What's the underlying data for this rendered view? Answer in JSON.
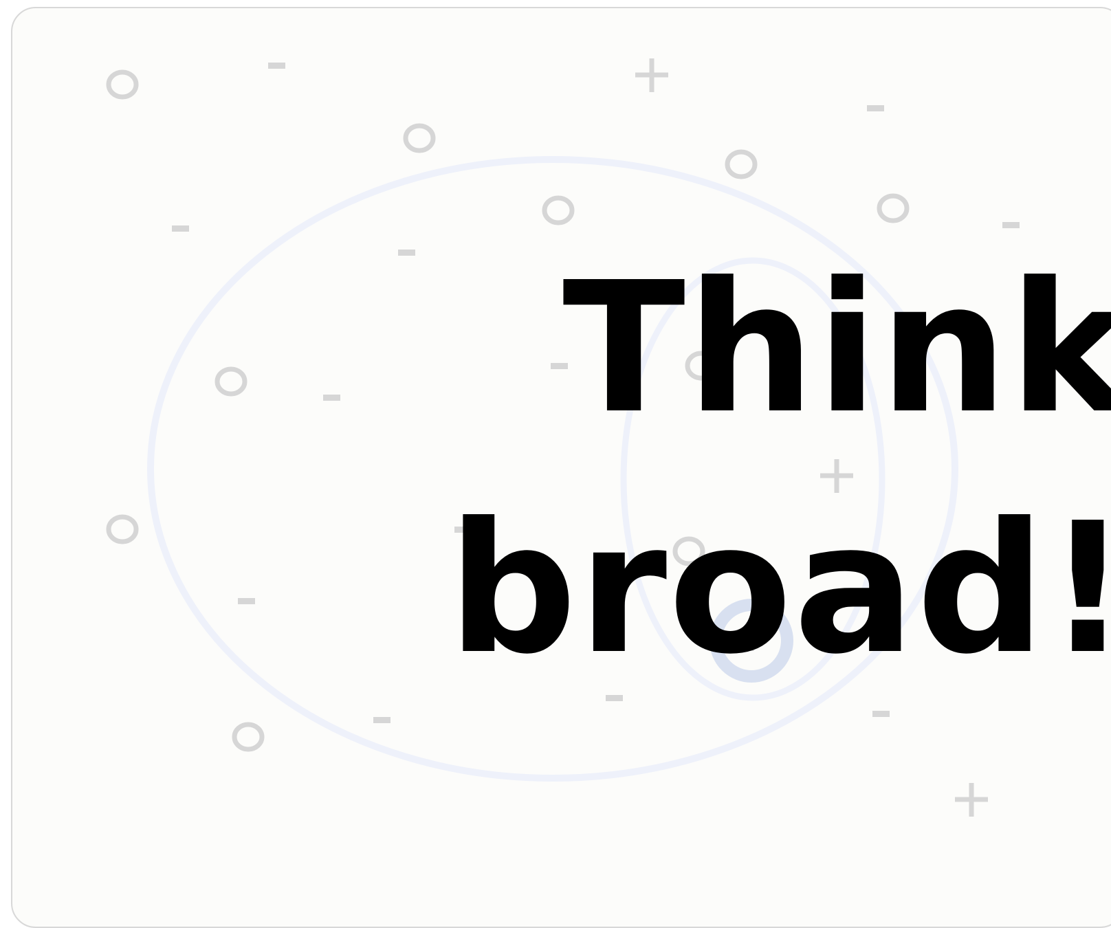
{
  "slide": {
    "headline_line1": "Think",
    "headline_line2": "broad!"
  },
  "decorations": {
    "circle_glyph": "○",
    "plus_glyph": "+",
    "minus_glyph": "-"
  },
  "colors": {
    "background": "#fcfcfa",
    "text": "#000000",
    "symbol": "#d6d6d6",
    "ring": "#eef1fa",
    "ring_inner": "#d8e0f0"
  }
}
